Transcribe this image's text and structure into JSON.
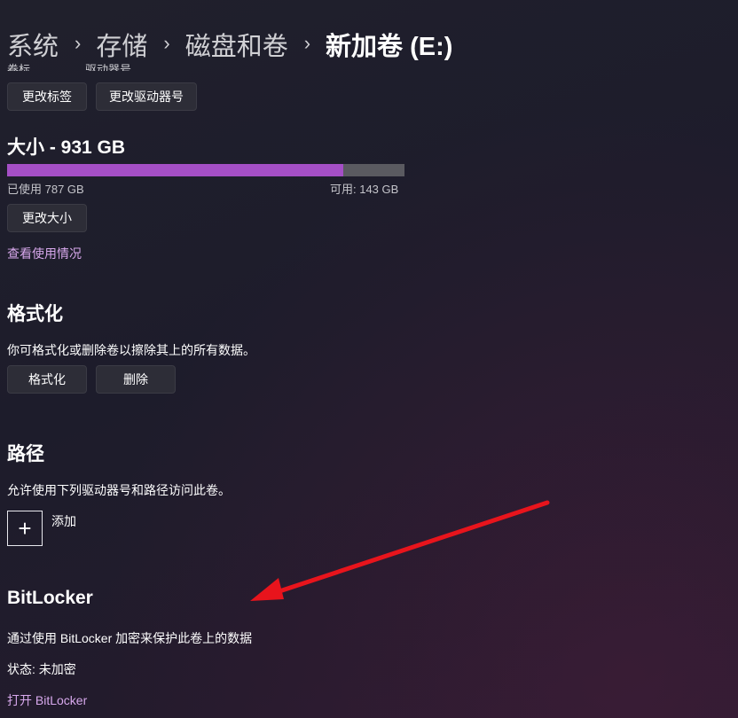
{
  "breadcrumb": {
    "items": [
      "系统",
      "存储",
      "磁盘和卷",
      "新加卷 (E:)"
    ],
    "separator": "›"
  },
  "clipped_labels": [
    "卷标",
    "驱动器号"
  ],
  "label_buttons": {
    "change_label": "更改标签",
    "change_drive_letter": "更改驱动器号"
  },
  "size": {
    "title": "大小 - 931 GB",
    "used_text": "已使用 787 GB",
    "free_text": "可用: 143 GB",
    "used_fraction": 0.845,
    "resize_button": "更改大小",
    "usage_link": "查看使用情况"
  },
  "format": {
    "title": "格式化",
    "description": "你可格式化或删除卷以擦除其上的所有数据。",
    "format_button": "格式化",
    "delete_button": "删除"
  },
  "paths": {
    "title": "路径",
    "description": "允许使用下列驱动器号和路径访问此卷。",
    "add_label": "添加"
  },
  "bitlocker": {
    "title": "BitLocker",
    "description": "通过使用 BitLocker 加密来保护此卷上的数据",
    "status": "状态: 未加密",
    "open_link": "打开 BitLocker"
  },
  "colors": {
    "accent": "#a54fc6",
    "link": "#d7a8ec",
    "annotation_arrow": "#e8141c"
  },
  "icons": {
    "add": "plus-icon",
    "breadcrumb_separator": "chevron-right-icon"
  }
}
